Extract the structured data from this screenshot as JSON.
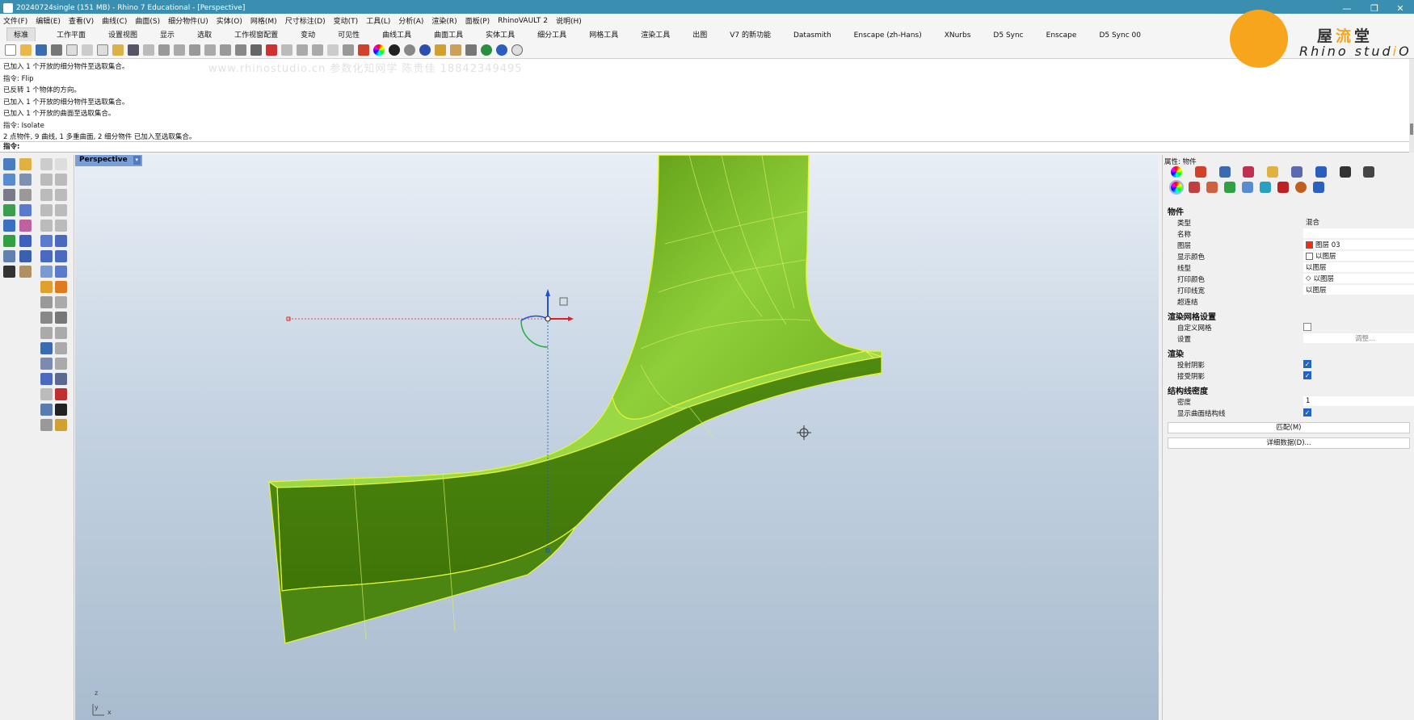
{
  "window": {
    "title": "20240724single (151 MB) - Rhino 7 Educational - [Perspective]",
    "controls": [
      "—",
      "❐",
      "✕"
    ]
  },
  "menu": [
    "文件(F)",
    "编辑(E)",
    "查看(V)",
    "曲线(C)",
    "曲面(S)",
    "细分物件(U)",
    "实体(O)",
    "网格(M)",
    "尺寸标注(D)",
    "变动(T)",
    "工具(L)",
    "分析(A)",
    "渲染(R)",
    "面板(P)",
    "RhinoVAULT 2",
    "说明(H)"
  ],
  "tabs": [
    "标准",
    "工作平面",
    "设置视图",
    "显示",
    "选取",
    "工作视窗配置",
    "变动",
    "可见性",
    "曲线工具",
    "曲面工具",
    "实体工具",
    "细分工具",
    "网格工具",
    "渲染工具",
    "出图",
    "V7 的新功能",
    "Datasmith",
    "Enscape (zh-Hans)",
    "XNurbs",
    "D5 Sync",
    "Enscape",
    "D5 Sync 00"
  ],
  "active_tab": "标准",
  "history": [
    "已加入 1 个开放的细分物件至选取集合。",
    "指令: Flip",
    "已反转 1 个物体的方向。",
    "已加入 1 个开放的细分物件至选取集合。",
    "已加入 1 个开放的曲面至选取集合。",
    "指令: Isolate",
    "2 点物件, 9 曲线, 1 多重曲面, 2 细分物件 已加入至选取集合。"
  ],
  "command_prompt": "指令:",
  "watermark": "www.rhinostudio.cn 参数化知网学 陈贵佳 18842349495",
  "logo": {
    "cn_a": "屋",
    "cn_b": "流",
    "cn_c": "堂",
    "en_a": "Rhino stud",
    "en_b": "i",
    "en_c": "O"
  },
  "viewport": {
    "label": "Perspective",
    "axis_z": "z",
    "axis_y": "y",
    "axis_x": "x"
  },
  "panel": {
    "title": "属性: 物件",
    "section_object": "物件",
    "type_label": "类型",
    "type_value": "混合",
    "name_label": "名称",
    "name_value": "",
    "layer_label": "图层",
    "layer_value": "图层 03",
    "layer_color": "#ff2a10",
    "display_color_label": "显示颜色",
    "display_color_value": "以图层",
    "linetype_label": "线型",
    "linetype_value": "以图层",
    "print_color_label": "打印颜色",
    "print_color_value": "以图层",
    "print_width_label": "打印线宽",
    "print_width_value": "以图层",
    "hyperlink_label": "超连结",
    "hyperlink_button": "...",
    "section_mesh": "渲染网格设置",
    "custom_mesh_label": "自定义网格",
    "settings_label": "设置",
    "settings_button": "调整...",
    "section_render": "渲染",
    "cast_shadow_label": "投射阴影",
    "receive_shadow_label": "接受阴影",
    "section_isocurve": "结构线密度",
    "density_label": "密度",
    "density_value": "1",
    "show_isocurves_label": "显示曲面结构线",
    "match_button": "匹配(M)",
    "details_button": "详细数据(D)..."
  },
  "colors": {
    "titlebar": "#3a8fb0",
    "object_green": "#6aa61a",
    "object_edge": "#e6f53a",
    "gumball_red": "#e02020",
    "gumball_blue": "#2050d0",
    "gumball_green": "#20b040"
  }
}
